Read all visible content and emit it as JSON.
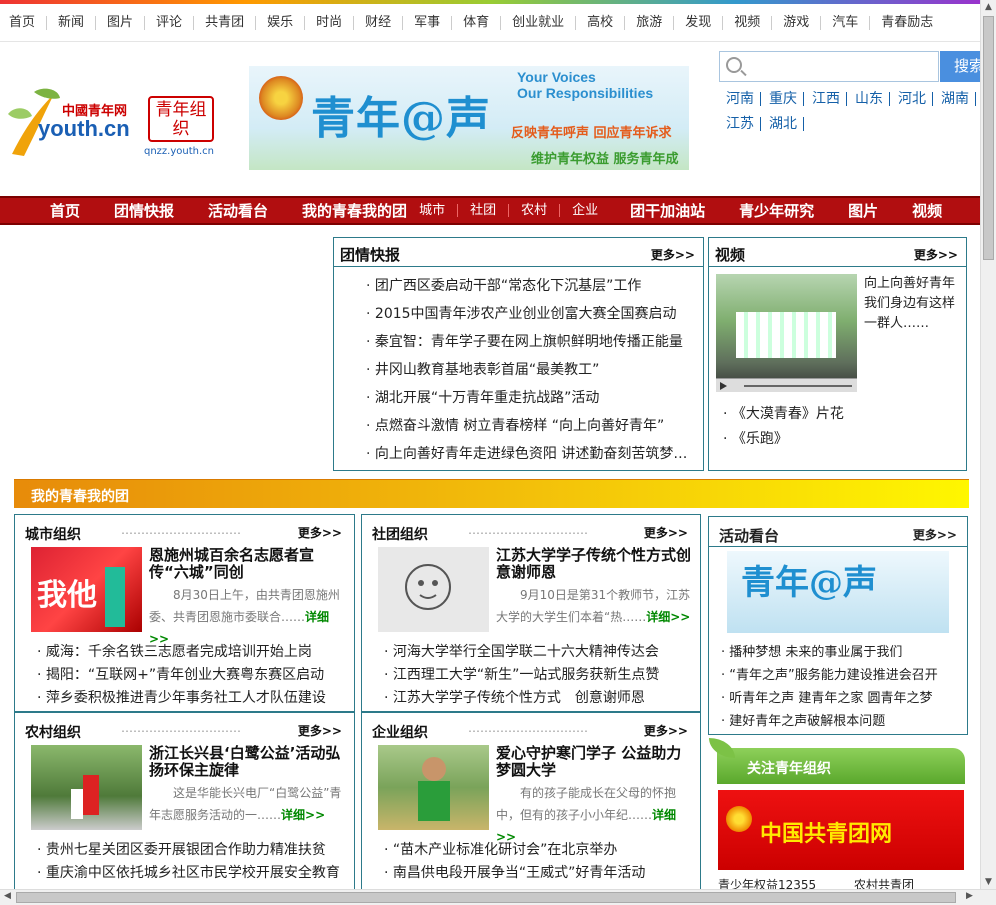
{
  "topnav": [
    "首页",
    "新闻",
    "图片",
    "评论",
    "共青团",
    "娱乐",
    "时尚",
    "财经",
    "军事",
    "体育",
    "创业就业",
    "高校",
    "旅游",
    "发现",
    "视频",
    "游戏",
    "汽车",
    "青春励志"
  ],
  "logo": {
    "cn": "中國青年网",
    "main": "youth.cn",
    "org": "青年组织",
    "url": "qnzz.youth.cn"
  },
  "banner": {
    "title": "青年@声",
    "en1": "Your Voices",
    "en2": "Our Responsibilities",
    "slogan1": "反映青年呼声 回应青年诉求",
    "slogan2": "维护青年权益 服务青年成长"
  },
  "search": {
    "button": "搜索"
  },
  "regions": [
    "河南",
    "重庆",
    "江西",
    "山东",
    "河北",
    "湖南",
    "江苏",
    "湖北"
  ],
  "mainnav": {
    "main": [
      "首页",
      "团情快报",
      "活动看台",
      "我的青春我的团"
    ],
    "sub": [
      "城市",
      "社团",
      "农村",
      "企业"
    ],
    "tail": [
      "团干加油站",
      "青少年研究",
      "图片",
      "视频"
    ]
  },
  "news": {
    "title": "团情快报",
    "more": "更多>>",
    "items": [
      "团广西区委启动干部“常态化下沉基层”工作",
      "2015中国青年涉农产业创业创富大赛全国赛启动",
      "秦宜智：青年学子要在网上旗帜鲜明地传播正能量",
      "井冈山教育基地表彰首届“最美教工”",
      "湖北开展“十万青年重走抗战路”活动",
      "点燃奋斗激情 树立青春榜样 “向上向善好青年”",
      "向上向善好青年走进绿色资阳 讲述勤奋刻苦筑梦故事"
    ]
  },
  "video": {
    "title": "视频",
    "more": "更多>>",
    "caption": "向上向善好青年我们身边有这样一群人……",
    "links": [
      "《大漠青春》片花",
      "《乐跑》"
    ]
  },
  "banner2": {
    "title": "我的青春我的团"
  },
  "city": {
    "title": "城市组织",
    "dots": "…………………………",
    "more": "更多>>",
    "headline": "恩施州城百余名志愿者宣传“六城”同创",
    "desc": "8月30日上午，由共青团恩施州委、共青团恩施市委联合……",
    "detail": "详细>>",
    "items": [
      "威海：千余名铁三志愿者完成培训开始上岗",
      "揭阳：“互联网+”青年创业大赛粤东赛区启动",
      "萍乡委积极推进青少年事务社工人才队伍建设"
    ]
  },
  "club": {
    "title": "社团组织",
    "dots": "…………………………",
    "more": "更多>>",
    "headline": "江苏大学学子传统个性方式创意谢师恩",
    "desc": "9月10日是第31个教师节，江苏大学的大学生们本着“热……",
    "detail": "详细>>",
    "items": [
      "河海大学举行全国学联二十六大精神传达会",
      "江西理工大学“新生”一站式服务获新生点赞",
      "江苏大学学子传统个性方式　创意谢师恩"
    ]
  },
  "rural": {
    "title": "农村组织",
    "dots": "…………………………",
    "more": "更多>>",
    "headline": "浙江长兴县‘白鹭公益’活动弘扬环保主旋律",
    "desc": "这是华能长兴电厂“白鹭公益”青年志愿服务活动的一……",
    "detail": "详细>>",
    "items": [
      "贵州七星关团区委开展银团合作助力精准扶贫",
      "重庆渝中区依托城乡社区市民学校开展安全教育"
    ]
  },
  "enterprise": {
    "title": "企业组织",
    "dots": "…………………………",
    "more": "更多>>",
    "headline": "爱心守护寒门学子 公益助力梦圆大学",
    "desc": "有的孩子能成长在父母的怀抱中，但有的孩子小小年纪……",
    "detail": "详细>>",
    "items": [
      "“苗木产业标准化研讨会”在北京举办",
      "南昌供电段开展争当“王威式”好青年活动"
    ]
  },
  "activity": {
    "title": "活动看台",
    "more": "更多>>",
    "img": "青年@声",
    "items": [
      "播种梦想 未来的事业属于我们",
      "“青年之声”服务能力建设推进会召开",
      "听青年之声 建青年之家 圆青年之梦",
      "建好青年之声破解根本问题"
    ]
  },
  "follow": {
    "title": "关注青年组织"
  },
  "gqt": {
    "title": "中国共青团网"
  },
  "bottom": [
    "青少年权益12355",
    "农村共青团"
  ]
}
